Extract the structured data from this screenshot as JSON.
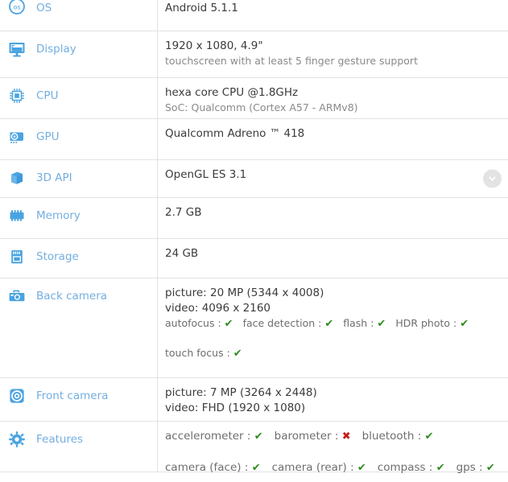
{
  "page": {
    "title": "Device specifications table",
    "accent_label_color": "#73aee0",
    "icon_color": "#4aa3e0",
    "value_color": "#3b3b3b",
    "muted_color": "#8a8a8a",
    "check_color": "#2f8a1f",
    "cross_color": "#c41c1c",
    "divider_color": "#e2e2e2",
    "background": "#ffffff"
  },
  "rows": [
    {
      "id": "os",
      "icon": "os-icon",
      "label": "OS",
      "value": "Android 5.1.1"
    },
    {
      "id": "display",
      "icon": "display-icon",
      "label": "Display",
      "value": "1920 x 1080, 4.9\"",
      "sub": "touchscreen with at least 5 finger gesture support"
    },
    {
      "id": "cpu",
      "icon": "cpu-icon",
      "label": "CPU",
      "value": "hexa core CPU @1.8GHz",
      "sub": "SoC: Qualcomm (Cortex A57 - ARMv8)"
    },
    {
      "id": "gpu",
      "icon": "gpu-icon",
      "label": "GPU",
      "value": "Qualcomm Adreno ™ 418"
    },
    {
      "id": "api3d",
      "icon": "cube-3d-icon",
      "label": "3D API",
      "value": "OpenGL ES 3.1",
      "expander": "chevron-down-icon"
    },
    {
      "id": "memory",
      "icon": "memory-icon",
      "label": "Memory",
      "value": "2.7 GB"
    },
    {
      "id": "storage",
      "icon": "storage-icon",
      "label": "Storage",
      "value": "24 GB"
    },
    {
      "id": "back-camera",
      "icon": "back-camera-icon",
      "label": "Back camera",
      "value": "picture: 20 MP (5344 x 4008)",
      "value2": "video: 4096 x 2160",
      "features_line1": [
        {
          "name": "autofocus",
          "state": "yes"
        },
        {
          "name": "face detection",
          "state": "yes"
        },
        {
          "name": "flash",
          "state": "yes"
        },
        {
          "name": "HDR photo",
          "state": "yes"
        }
      ],
      "features_line2": [
        {
          "name": "touch focus",
          "state": "yes"
        }
      ]
    },
    {
      "id": "front-camera",
      "icon": "front-camera-icon",
      "label": "Front camera",
      "value": "picture: 7 MP (3264 x 2448)",
      "value2": "video: FHD (1920 x 1080)"
    },
    {
      "id": "features",
      "icon": "gear-icon",
      "label": "Features",
      "features_line1": [
        {
          "name": "accelerometer",
          "state": "yes"
        },
        {
          "name": "barometer",
          "state": "no"
        },
        {
          "name": "bluetooth",
          "state": "yes"
        }
      ],
      "features_line2": [
        {
          "name": "camera (face)",
          "state": "yes"
        },
        {
          "name": "camera (rear)",
          "state": "yes"
        },
        {
          "name": "compass",
          "state": "yes"
        },
        {
          "name": "gps",
          "state": "yes"
        }
      ]
    }
  ],
  "glyphs": {
    "check": "✔",
    "cross": "✖",
    "separator": " : "
  }
}
